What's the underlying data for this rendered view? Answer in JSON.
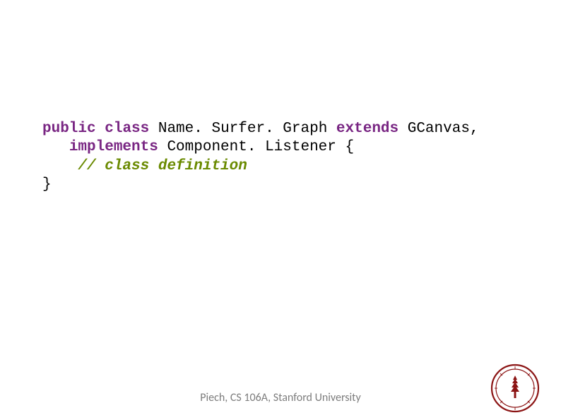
{
  "code": {
    "line1": {
      "kw_public": "public",
      "kw_class": "class",
      "name": " Name. Surfer. Graph ",
      "kw_extends": "extends",
      "rest": " GCanvas,"
    },
    "line2": {
      "lead": "   ",
      "kw_implements": "implements",
      "rest": " Component. Listener {"
    },
    "line3": {
      "lead": "    ",
      "comment": "// class definition"
    },
    "line4": {
      "brace": "}"
    }
  },
  "footer": "Piech, CS 106A, Stanford University",
  "seal_alt": "Stanford University seal"
}
